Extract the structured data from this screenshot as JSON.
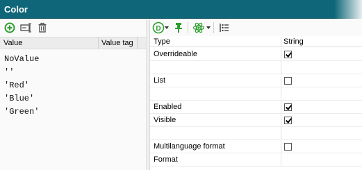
{
  "window": {
    "title": "Color"
  },
  "left_panel": {
    "toolbar": [
      {
        "name": "add-icon",
        "color": "#2e9e2e"
      },
      {
        "name": "rename-field-icon"
      },
      {
        "name": "delete-icon"
      }
    ],
    "columns": [
      "Value",
      "Value tag"
    ],
    "values": [
      "NoValue",
      "''",
      "'Red'",
      "'Blue'",
      "'Green'"
    ]
  },
  "right_panel": {
    "toolbar": [
      {
        "name": "data-type-icon",
        "label": "D"
      },
      {
        "name": "pin-icon"
      },
      {
        "name": "atom-icon"
      },
      {
        "name": "list-view-icon"
      }
    ],
    "columns": {
      "type": "Type",
      "string": "String"
    },
    "rows": [
      {
        "label": "Overrideable",
        "checkbox": true,
        "checked": true
      },
      {
        "label": "",
        "checkbox": false,
        "checked": false
      },
      {
        "label": "List",
        "checkbox": true,
        "checked": false
      },
      {
        "label": "",
        "checkbox": false,
        "checked": false
      },
      {
        "label": "Enabled",
        "checkbox": true,
        "checked": true
      },
      {
        "label": "Visible",
        "checkbox": true,
        "checked": true
      },
      {
        "label": "",
        "checkbox": false,
        "checked": false
      },
      {
        "label": "Multilanguage format",
        "checkbox": true,
        "checked": false
      },
      {
        "label": "Format",
        "checkbox": false,
        "checked": false
      }
    ]
  },
  "colors": {
    "titlebar": "#0f6678",
    "accent_green": "#2e9e2e"
  }
}
